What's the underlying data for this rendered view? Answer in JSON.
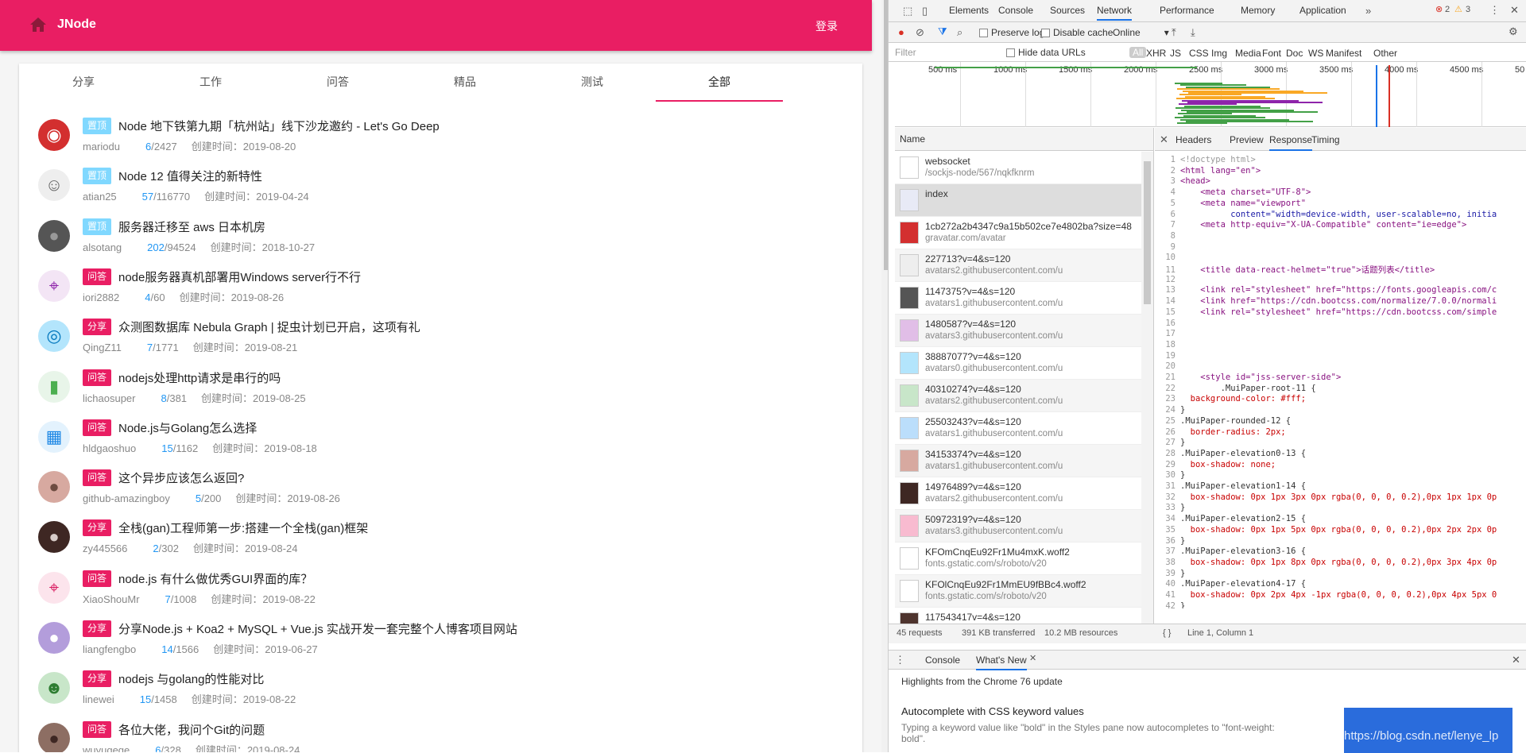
{
  "app": {
    "brand": "JNode",
    "login": "登录"
  },
  "tabs": [
    "分享",
    "工作",
    "问答",
    "精品",
    "测试",
    "全部"
  ],
  "topics": [
    {
      "badge": "置顶",
      "badge_color": "#80d8ff",
      "title": "Node 地下铁第九期「杭州站」线下沙龙邀约 - Let's Go Deep",
      "author": "mariodu",
      "replies": "6",
      "views": "/2427",
      "time": "创建时间：2019-08-20",
      "avatar": "mushroom"
    },
    {
      "badge": "置顶",
      "badge_color": "#80d8ff",
      "title": "Node 12 值得关注的新特性",
      "author": "atian25",
      "replies": "57",
      "views": "/116770",
      "time": "创建时间：2019-04-24",
      "avatar": "cartoon"
    },
    {
      "badge": "置顶",
      "badge_color": "#80d8ff",
      "title": "服务器迁移至 aws 日本机房",
      "author": "alsotang",
      "replies": "202",
      "views": "/94524",
      "time": "创建时间：2018-10-27",
      "avatar": "photo"
    },
    {
      "badge": "问答",
      "badge_color": "#e91e63",
      "title": "node服务器真机部署用Windows server行不行",
      "author": "iori2882",
      "replies": "4",
      "views": "/60",
      "time": "创建时间：2019-08-26",
      "avatar": "purple"
    },
    {
      "badge": "分享",
      "badge_color": "#e91e63",
      "title": "众测图数据库 Nebula Graph | 捉虫计划已开启，这项有礼",
      "author": "QingZ11",
      "replies": "7",
      "views": "/1771",
      "time": "创建时间：2019-08-21",
      "avatar": "blue"
    },
    {
      "badge": "问答",
      "badge_color": "#e91e63",
      "title": "nodejs处理http请求是串行的吗",
      "author": "lichaosuper",
      "replies": "8",
      "views": "/381",
      "time": "创建时间：2019-08-25",
      "avatar": "green"
    },
    {
      "badge": "问答",
      "badge_color": "#e91e63",
      "title": "Node.js与Golang怎么选择",
      "author": "hldgaoshuo",
      "replies": "15",
      "views": "/1162",
      "time": "创建时间：2019-08-18",
      "avatar": "lightblue"
    },
    {
      "badge": "问答",
      "badge_color": "#e91e63",
      "title": "这个异步应该怎么返回?",
      "author": "github-amazingboy",
      "replies": "5",
      "views": "/200",
      "time": "创建时间：2019-08-26",
      "avatar": "girl"
    },
    {
      "badge": "分享",
      "badge_color": "#e91e63",
      "title": "全栈(gan)工程师第一步:搭建一个全栈(gan)框架",
      "author": "zy445566",
      "replies": "2",
      "views": "/302",
      "time": "创建时间：2019-08-24",
      "avatar": "face"
    },
    {
      "badge": "问答",
      "badge_color": "#e91e63",
      "title": "node.js 有什么做优秀GUI界面的库？",
      "author": "XiaoShouMr",
      "replies": "7",
      "views": "/1008",
      "time": "创建时间：2019-08-22",
      "avatar": "pink"
    },
    {
      "badge": "分享",
      "badge_color": "#e91e63",
      "title": "分享Node.js + Koa2 + MySQL + Vue.js 实战开发一套完整个人博客项目网站",
      "author": "liangfengbo",
      "replies": "14",
      "views": "/1566",
      "time": "创建时间：2019-06-27",
      "avatar": "anime"
    },
    {
      "badge": "分享",
      "badge_color": "#e91e63",
      "title": "nodejs 与golang的性能对比",
      "author": "linewei",
      "replies": "15",
      "views": "/1458",
      "time": "创建时间：2019-08-22",
      "avatar": "mario"
    },
    {
      "badge": "问答",
      "badge_color": "#e91e63",
      "title": "各位大佬，我问个Git的问题",
      "author": "wuyugege",
      "replies": "6",
      "views": "/328",
      "time": "创建时间：2019-08-24",
      "avatar": "woman"
    }
  ],
  "devtools": {
    "tabs": [
      "Elements",
      "Console",
      "Sources",
      "Network",
      "Performance",
      "Memory",
      "Application"
    ],
    "active_tab": "Network",
    "errors": "2",
    "warnings": "3",
    "preserve_log": "Preserve log",
    "disable_cache": "Disable cache",
    "throttle": "Online",
    "filter_placeholder": "Filter",
    "hide_data_urls": "Hide data URLs",
    "filter_types": [
      "All",
      "XHR",
      "JS",
      "CSS",
      "Img",
      "Media",
      "Font",
      "Doc",
      "WS",
      "Manifest",
      "Other"
    ],
    "ticks": [
      "500 ms",
      "1000 ms",
      "1500 ms",
      "2000 ms",
      "2500 ms",
      "3000 ms",
      "3500 ms",
      "4000 ms",
      "4500 ms",
      "50"
    ],
    "name_header": "Name",
    "requests": [
      {
        "name": "websocket",
        "host": "/sockjs-node/567/nqkfknrm"
      },
      {
        "name": "index",
        "host": ""
      },
      {
        "name": "1cb272a2b4347c9a15b502ce7e4802ba?size=48",
        "host": "gravatar.com/avatar"
      },
      {
        "name": "227713?v=4&s=120",
        "host": "avatars2.githubusercontent.com/u"
      },
      {
        "name": "1147375?v=4&s=120",
        "host": "avatars1.githubusercontent.com/u"
      },
      {
        "name": "1480587?v=4&s=120",
        "host": "avatars3.githubusercontent.com/u"
      },
      {
        "name": "38887077?v=4&s=120",
        "host": "avatars0.githubusercontent.com/u"
      },
      {
        "name": "40310274?v=4&s=120",
        "host": "avatars2.githubusercontent.com/u"
      },
      {
        "name": "25503243?v=4&s=120",
        "host": "avatars1.githubusercontent.com/u"
      },
      {
        "name": "34153374?v=4&s=120",
        "host": "avatars1.githubusercontent.com/u"
      },
      {
        "name": "14976489?v=4&s=120",
        "host": "avatars2.githubusercontent.com/u"
      },
      {
        "name": "50972319?v=4&s=120",
        "host": "avatars3.githubusercontent.com/u"
      },
      {
        "name": "KFOmCnqEu92Fr1Mu4mxK.woff2",
        "host": "fonts.gstatic.com/s/roboto/v20"
      },
      {
        "name": "KFOlCnqEu92Fr1MmEU9fBBc4.woff2",
        "host": "fonts.gstatic.com/s/roboto/v20"
      },
      {
        "name": "117543417v=4&s=120",
        "host": ""
      }
    ],
    "detail_tabs": [
      "Headers",
      "Preview",
      "Response",
      "Timing"
    ],
    "active_detail": "Response",
    "code_lines": [
      {
        "n": "1",
        "t": "<!doctype html>",
        "c": "#999"
      },
      {
        "n": "2",
        "t": "<html lang=\"en\">",
        "c": "#881280"
      },
      {
        "n": "3",
        "t": "<head>",
        "c": "#881280"
      },
      {
        "n": "4",
        "t": "    <meta charset=\"UTF-8\">",
        "c": "#881280"
      },
      {
        "n": "5",
        "t": "    <meta name=\"viewport\"",
        "c": "#881280"
      },
      {
        "n": "6",
        "t": "          content=\"width=device-width, user-scalable=no, initia",
        "c": "#1a1aa6"
      },
      {
        "n": "7",
        "t": "    <meta http-equiv=\"X-UA-Compatible\" content=\"ie=edge\">",
        "c": "#881280"
      },
      {
        "n": "8",
        "t": "",
        "c": "#333"
      },
      {
        "n": "9",
        "t": "",
        "c": "#333"
      },
      {
        "n": "10",
        "t": "",
        "c": "#333"
      },
      {
        "n": "11",
        "t": "    <title data-react-helmet=\"true\">话题列表</title>",
        "c": "#881280"
      },
      {
        "n": "12",
        "t": "",
        "c": "#333"
      },
      {
        "n": "13",
        "t": "    <link rel=\"stylesheet\" href=\"https://fonts.googleapis.com/c",
        "c": "#881280"
      },
      {
        "n": "14",
        "t": "    <link href=\"https://cdn.bootcss.com/normalize/7.0.0/normali",
        "c": "#881280"
      },
      {
        "n": "15",
        "t": "    <link rel=\"stylesheet\" href=\"https://cdn.bootcss.com/simple",
        "c": "#881280"
      },
      {
        "n": "16",
        "t": "",
        "c": "#333"
      },
      {
        "n": "17",
        "t": "",
        "c": "#333"
      },
      {
        "n": "18",
        "t": "",
        "c": "#333"
      },
      {
        "n": "19",
        "t": "",
        "c": "#333"
      },
      {
        "n": "20",
        "t": "",
        "c": "#333"
      },
      {
        "n": "21",
        "t": "    <style id=\"jss-server-side\">",
        "c": "#881280"
      },
      {
        "n": "22",
        "t": "        .MuiPaper-root-11 {",
        "c": "#333"
      },
      {
        "n": "23",
        "t": "  background-color: #fff;",
        "c": "#c80000"
      },
      {
        "n": "24",
        "t": "}",
        "c": "#333"
      },
      {
        "n": "25",
        "t": ".MuiPaper-rounded-12 {",
        "c": "#333"
      },
      {
        "n": "26",
        "t": "  border-radius: 2px;",
        "c": "#c80000"
      },
      {
        "n": "27",
        "t": "}",
        "c": "#333"
      },
      {
        "n": "28",
        "t": ".MuiPaper-elevation0-13 {",
        "c": "#333"
      },
      {
        "n": "29",
        "t": "  box-shadow: none;",
        "c": "#c80000"
      },
      {
        "n": "30",
        "t": "}",
        "c": "#333"
      },
      {
        "n": "31",
        "t": ".MuiPaper-elevation1-14 {",
        "c": "#333"
      },
      {
        "n": "32",
        "t": "  box-shadow: 0px 1px 3px 0px rgba(0, 0, 0, 0.2),0px 1px 1px 0p",
        "c": "#c80000"
      },
      {
        "n": "33",
        "t": "}",
        "c": "#333"
      },
      {
        "n": "34",
        "t": ".MuiPaper-elevation2-15 {",
        "c": "#333"
      },
      {
        "n": "35",
        "t": "  box-shadow: 0px 1px 5px 0px rgba(0, 0, 0, 0.2),0px 2px 2px 0p",
        "c": "#c80000"
      },
      {
        "n": "36",
        "t": "}",
        "c": "#333"
      },
      {
        "n": "37",
        "t": ".MuiPaper-elevation3-16 {",
        "c": "#333"
      },
      {
        "n": "38",
        "t": "  box-shadow: 0px 1px 8px 0px rgba(0, 0, 0, 0.2),0px 3px 4px 0p",
        "c": "#c80000"
      },
      {
        "n": "39",
        "t": "}",
        "c": "#333"
      },
      {
        "n": "40",
        "t": ".MuiPaper-elevation4-17 {",
        "c": "#333"
      },
      {
        "n": "41",
        "t": "  box-shadow: 0px 2px 4px -1px rgba(0, 0, 0, 0.2),0px 4px 5px 0",
        "c": "#c80000"
      },
      {
        "n": "42",
        "t": "}",
        "c": "#333"
      }
    ],
    "status_requests": "45 requests",
    "status_transferred": "391 KB transferred",
    "status_resources": "10.2 MB resources",
    "cursor_pos": "Line 1, Column 1",
    "drawer_tabs": [
      "Console",
      "What's New"
    ],
    "drawer_heading": "Highlights from the Chrome 76 update",
    "news_title": "Autocomplete with CSS keyword values",
    "news_text": "Typing a keyword value like \"bold\" in the Styles pane now autocompletes to \"font-weight: bold\".",
    "watermark": "https://blog.csdn.net/lenye_lp"
  }
}
